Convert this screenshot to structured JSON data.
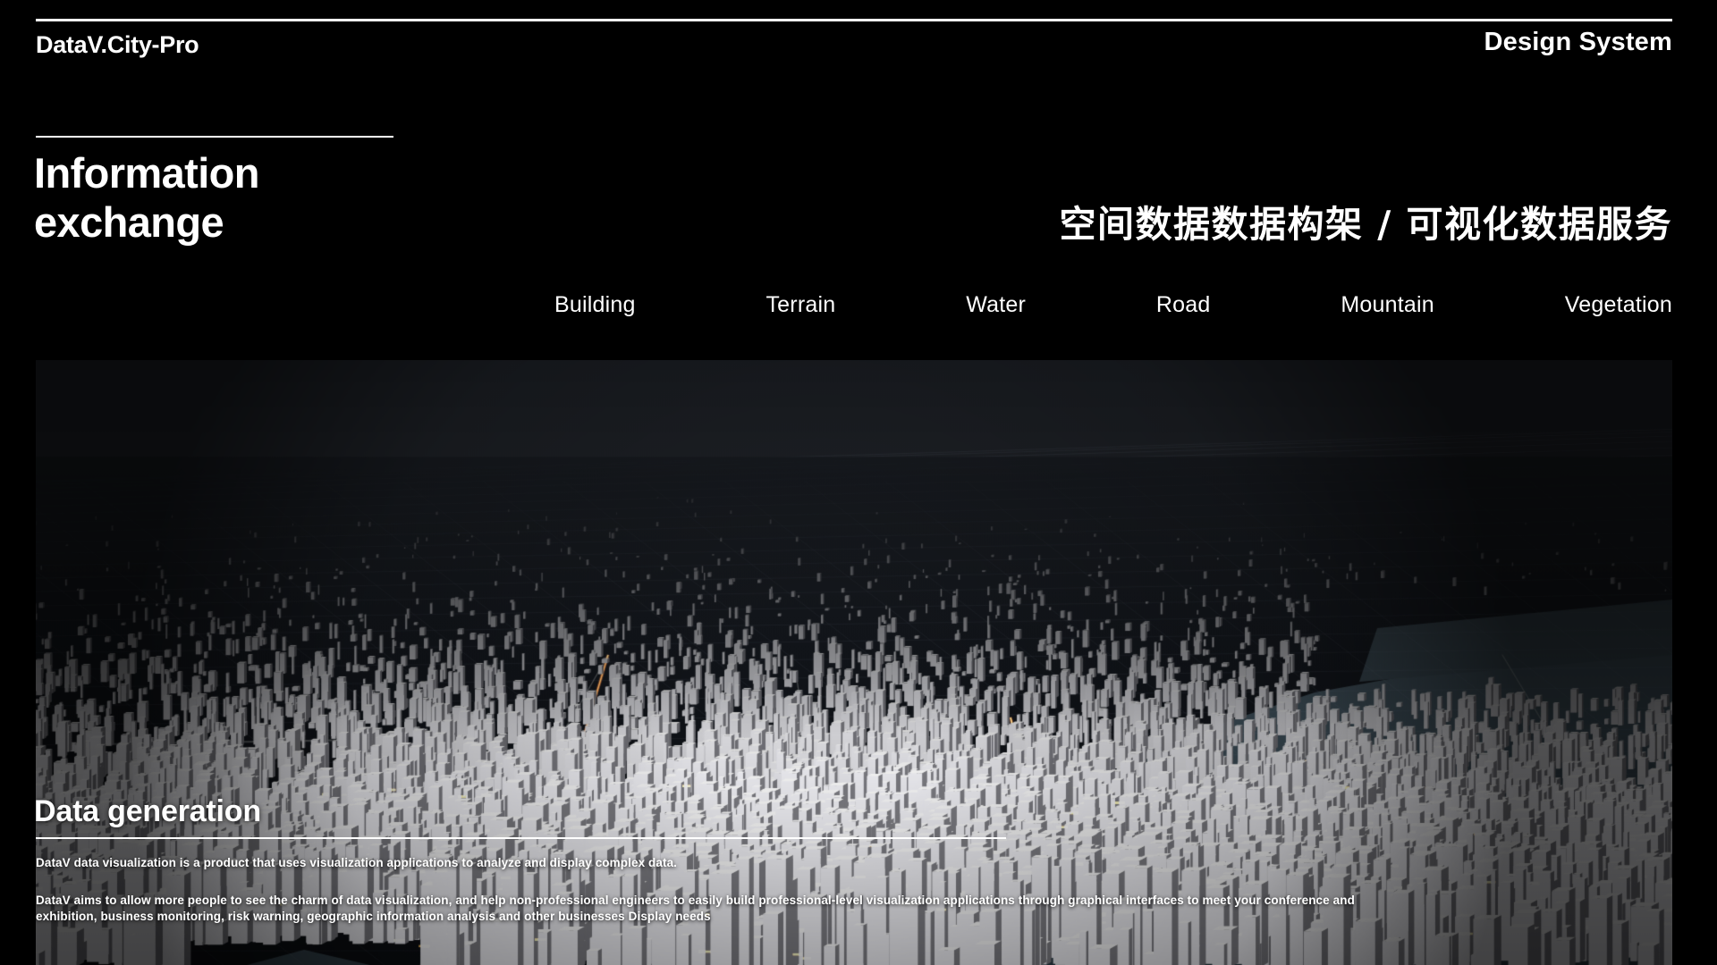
{
  "header": {
    "brand": "DataV.City-Pro",
    "right_label": "Design System"
  },
  "hero_section": {
    "headline_line1": "Information",
    "headline_line2": "exchange",
    "subtitle_cn": "空间数据数据构架 / 可视化数据服务"
  },
  "nav": {
    "items": [
      {
        "label": "Building"
      },
      {
        "label": "Terrain"
      },
      {
        "label": "Water"
      },
      {
        "label": "Road"
      },
      {
        "label": "Mountain"
      },
      {
        "label": "Vegetation"
      }
    ]
  },
  "caption": {
    "title": "Data generation",
    "paragraph_1": "DataV data visualization is a product that uses visualization applications to analyze and display complex data.",
    "paragraph_2": "DataV aims to allow more people to see the charm of data visualization, and help non-professional engineers to easily build professional-level visualization applications through graphical interfaces to meet your conference and exhibition, business monitoring, risk warning, geographic information analysis and other businesses Display needs"
  },
  "colors": {
    "background": "#000000",
    "foreground": "#ffffff",
    "hero_sky": "#1a1d22",
    "hero_ground": "#15181d",
    "water": "#3d4c57",
    "building": "#e8eaec",
    "road_light": "#d4763a"
  }
}
